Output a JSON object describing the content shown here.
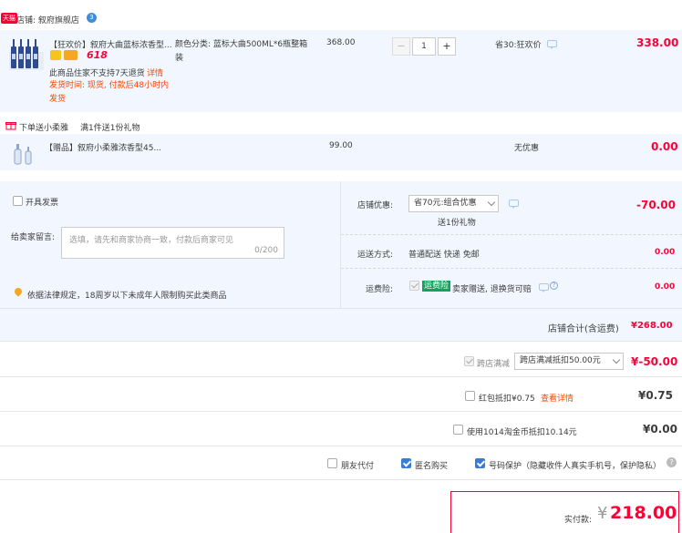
{
  "shop": {
    "badge": "天猫",
    "label": "店铺: 叙府旗舰店",
    "wang_badge": "3"
  },
  "item1": {
    "title": "【狂欢价】叙府大曲蓝标浓香型...",
    "tag_618": "618",
    "sku": "颜色分类: 蓝标大曲500ML*6瓶整箱装",
    "unit_price": "368.00",
    "qty": "1",
    "qty_minus": "−",
    "qty_plus": "+",
    "promo": "省30:狂欢价",
    "total": "338.00",
    "note1": "此商品住家不支持7天退货",
    "note1_link": "详情",
    "note2": "发货时间: 现货, 付款后48小时内发货"
  },
  "gift": {
    "header": "下单送小柔雅",
    "header_detail": "满1件送1份礼物",
    "title": "【赠品】叙府小柔雅浓香型45...",
    "unit_price": "99.00",
    "promo": "无优惠",
    "total": "0.00"
  },
  "invoice": {
    "label": "开具发票"
  },
  "message": {
    "label": "给卖家留言:",
    "placeholder": "选填，请先和商家协商一致，付款后商家可见",
    "counter": "0/200"
  },
  "legal": {
    "text": "依据法律规定，18周岁以下未成年人限制购买此类商品"
  },
  "store_discount": {
    "label": "店铺优惠:",
    "select": "省70元:组合优惠",
    "gift": "送1份礼物",
    "amount": "-70.00"
  },
  "shipping": {
    "label": "运送方式:",
    "value": "普通配送 快递 免邮",
    "amount": "0.00"
  },
  "freight_ins": {
    "label": "运费险:",
    "badge": "运费险",
    "text": "卖家赠送, 退换货可赔",
    "amount": "0.00"
  },
  "store_total": {
    "label": "店铺合计(含运费)",
    "amount": "¥268.00"
  },
  "cross_store": {
    "label": "跨店满减",
    "select": "跨店满减抵扣50.00元",
    "amount": "¥-50.00"
  },
  "redpacket": {
    "label": "红包抵扣¥0.75",
    "link": "查看详情",
    "amount": "¥0.75"
  },
  "taojinbi": {
    "label": "使用1014淘金币抵扣10.14元",
    "amount": "¥0.00"
  },
  "options": {
    "friend_pay": "朋友代付",
    "anonymous": "匿名购买",
    "privacy": "号码保护（隐藏收件人真实手机号，保护隐私）"
  },
  "payable": {
    "label": "实付款:",
    "currency": "¥",
    "amount": "218.00"
  },
  "colors": {
    "accent_red": "#ff0036",
    "orange": "#ff4400",
    "panel_blue": "#f2f7ff",
    "check_blue": "#3b7bd8",
    "wang_blue": "#3c8fd8"
  }
}
